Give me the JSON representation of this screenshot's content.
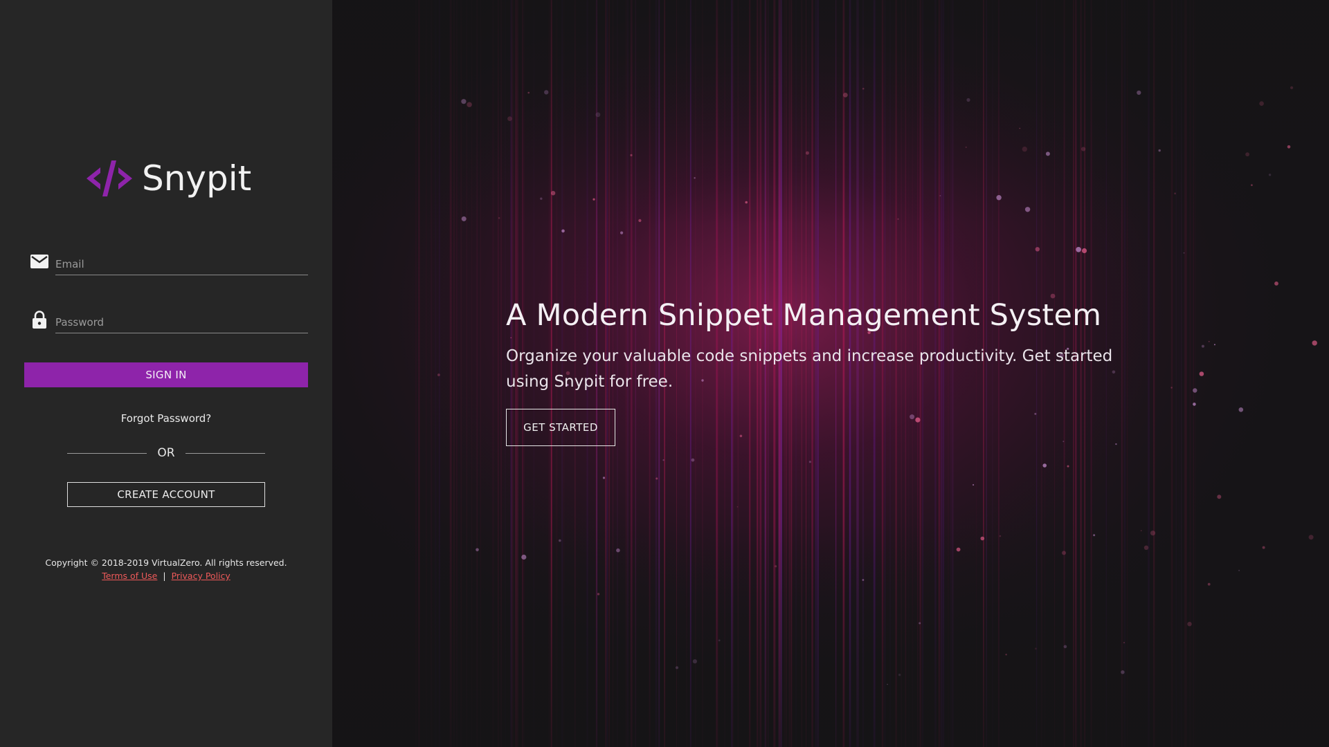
{
  "app": {
    "name": "Snypit",
    "brand_color": "#8e24aa"
  },
  "login": {
    "email_placeholder": "Email",
    "password_placeholder": "Password",
    "email_icon": "mail-icon",
    "password_icon": "lock-icon",
    "signin_label": "SIGN IN",
    "forgot_label": "Forgot Password?",
    "or_label": "OR",
    "create_account_label": "CREATE ACCOUNT"
  },
  "footer": {
    "copyright": "Copyright © 2018-2019 VirtualZero. All rights reserved.",
    "terms_label": "Terms of Use",
    "separator": "|",
    "privacy_label": "Privacy Policy",
    "link_color": "#ef5a5a"
  },
  "hero": {
    "title": "A Modern Snippet Management System",
    "subtitle": "Organize your valuable code snippets and increase productivity. Get started using Snypit for free.",
    "cta_label": "GET STARTED"
  }
}
